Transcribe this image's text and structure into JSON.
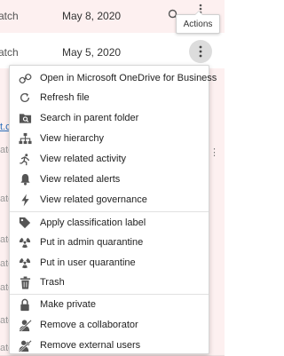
{
  "table": {
    "rows": [
      {
        "truncated": "atch",
        "date": "May 8, 2020"
      },
      {
        "truncated": "atch",
        "date": "May 5, 2020"
      }
    ],
    "left_strip": [
      "t.c",
      "atc",
      "atc",
      "atc",
      "atc",
      "atc",
      "atc",
      "atc"
    ]
  },
  "tooltip": {
    "label": "Actions"
  },
  "menu": {
    "items": [
      {
        "label": "Open in Microsoft OneDrive for Business",
        "icon": "link-icon"
      },
      {
        "label": "Refresh file",
        "icon": "refresh-icon"
      },
      {
        "label": "Search in parent folder",
        "icon": "folder-search-icon"
      },
      {
        "label": "View hierarchy",
        "icon": "hierarchy-icon"
      },
      {
        "label": "View related activity",
        "icon": "activity-icon"
      },
      {
        "label": "View related alerts",
        "icon": "bell-icon"
      },
      {
        "label": "View related governance",
        "icon": "lightning-icon"
      },
      {
        "label": "Apply classification label",
        "icon": "tag-icon"
      },
      {
        "label": "Put in admin quarantine",
        "icon": "radiation-icon"
      },
      {
        "label": "Put in user quarantine",
        "icon": "radiation-icon"
      },
      {
        "label": "Trash",
        "icon": "trash-icon"
      },
      {
        "label": "Make private",
        "icon": "lock-icon"
      },
      {
        "label": "Remove a collaborator",
        "icon": "user-remove-icon"
      },
      {
        "label": "Remove external users",
        "icon": "users-remove-icon"
      }
    ]
  },
  "colors": {
    "row_tint": "#fdf0f0",
    "accent_link": "#2a6ebb",
    "more_button_bg": "#dcdcdc"
  }
}
